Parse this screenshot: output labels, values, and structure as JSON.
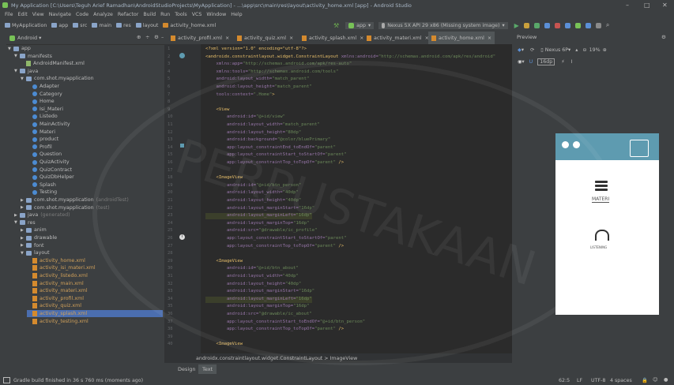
{
  "window": {
    "title": "My Application [C:\\Users\\Teguh Arief Ramadhan\\AndroidStudioProjects\\MyApplication] - ...\\app\\src\\main\\res\\layout\\activity_home.xml [app] - Android Studio"
  },
  "menu": [
    "File",
    "Edit",
    "View",
    "Navigate",
    "Code",
    "Analyze",
    "Refactor",
    "Build",
    "Run",
    "Tools",
    "VCS",
    "Window",
    "Help"
  ],
  "breadcrumb": [
    "MyApplication",
    "app",
    "src",
    "main",
    "res",
    "layout",
    "activity_home.xml"
  ],
  "toolbar": {
    "run_config": "app",
    "device": "Nexus 5X API 29 x86 (Missing system image)"
  },
  "project_panel": {
    "view_selector": "Android",
    "tree": [
      {
        "label": "app",
        "kind": "folder",
        "depth": 0,
        "open": true
      },
      {
        "label": "manifests",
        "kind": "folder",
        "depth": 1,
        "open": true
      },
      {
        "label": "AndroidManifest.xml",
        "kind": "manifest",
        "depth": 2
      },
      {
        "label": "java",
        "kind": "folder",
        "depth": 1,
        "open": true
      },
      {
        "label": "com.shot.myapplication",
        "kind": "folder",
        "depth": 2,
        "open": true
      },
      {
        "label": "Adapter",
        "kind": "class",
        "depth": 3
      },
      {
        "label": "Category",
        "kind": "class",
        "depth": 3
      },
      {
        "label": "Home",
        "kind": "class",
        "depth": 3
      },
      {
        "label": "Isi_Materi",
        "kind": "class",
        "depth": 3
      },
      {
        "label": "Listedo",
        "kind": "class",
        "depth": 3
      },
      {
        "label": "MainActivity",
        "kind": "class",
        "depth": 3
      },
      {
        "label": "Materi",
        "kind": "class",
        "depth": 3
      },
      {
        "label": "product",
        "kind": "class",
        "depth": 3
      },
      {
        "label": "Profil",
        "kind": "class",
        "depth": 3
      },
      {
        "label": "Question",
        "kind": "class",
        "depth": 3
      },
      {
        "label": "QuizActivity",
        "kind": "class",
        "depth": 3
      },
      {
        "label": "QuizContract",
        "kind": "class",
        "depth": 3
      },
      {
        "label": "QuizDbHelper",
        "kind": "class",
        "depth": 3
      },
      {
        "label": "Splash",
        "kind": "class",
        "depth": 3
      },
      {
        "label": "Testing",
        "kind": "class",
        "depth": 3
      },
      {
        "label": "com.shot.myapplication",
        "suffix": "(androidTest)",
        "kind": "folder",
        "depth": 2
      },
      {
        "label": "com.shot.myapplication",
        "suffix": "(test)",
        "kind": "folder",
        "depth": 2
      },
      {
        "label": "java",
        "suffix": "(generated)",
        "kind": "folder",
        "depth": 1
      },
      {
        "label": "res",
        "kind": "folder",
        "depth": 1,
        "open": true
      },
      {
        "label": "anim",
        "kind": "folder",
        "depth": 2
      },
      {
        "label": "drawable",
        "kind": "folder",
        "depth": 2
      },
      {
        "label": "font",
        "kind": "folder",
        "depth": 2
      },
      {
        "label": "layout",
        "kind": "folder",
        "depth": 2,
        "open": true
      },
      {
        "label": "activity_home.xml",
        "kind": "xml",
        "depth": 3
      },
      {
        "label": "activity_isi_materi.xml",
        "kind": "xml",
        "depth": 3
      },
      {
        "label": "activity_listedo.xml",
        "kind": "xml",
        "depth": 3
      },
      {
        "label": "activity_main.xml",
        "kind": "xml",
        "depth": 3
      },
      {
        "label": "activity_materi.xml",
        "kind": "xml",
        "depth": 3
      },
      {
        "label": "activity_profil.xml",
        "kind": "xml",
        "depth": 3
      },
      {
        "label": "activity_quiz.xml",
        "kind": "xml",
        "depth": 3
      },
      {
        "label": "activity_splash.xml",
        "kind": "xml",
        "depth": 3,
        "selected": true
      },
      {
        "label": "activity_testing.xml",
        "kind": "xml",
        "depth": 3
      }
    ]
  },
  "editor_tabs": [
    {
      "label": "activity_profil.xml",
      "active": false
    },
    {
      "label": "activity_quiz.xml",
      "active": false
    },
    {
      "label": "activity_splash.xml",
      "active": false
    },
    {
      "label": "activity_materi.xml",
      "active": false
    },
    {
      "label": "activity_home.xml",
      "active": true
    }
  ],
  "code_lines": [
    {
      "n": "1",
      "parts": [
        [
          "tg",
          "<?xml version=\"1.0\" encoding=\"utf-8\"?>"
        ]
      ]
    },
    {
      "n": "2",
      "parts": [
        [
          "tg",
          "<androidx.constraintlayout.widget.ConstraintLayout "
        ],
        [
          "at",
          "xmlns:android="
        ],
        [
          "st",
          "\"http://schemas.android.com/apk/res/android\""
        ]
      ]
    },
    {
      "n": "3",
      "parts": [
        [
          "at",
          "    xmlns:app="
        ],
        [
          "st",
          "\"http://schemas.android.com/apk/res-auto\""
        ]
      ]
    },
    {
      "n": "4",
      "parts": [
        [
          "at",
          "    xmlns:tools="
        ],
        [
          "st",
          "\"http://schemas.android.com/tools\""
        ]
      ]
    },
    {
      "n": "5",
      "parts": [
        [
          "at",
          "    android:layout_width="
        ],
        [
          "st",
          "\"match_parent\""
        ]
      ]
    },
    {
      "n": "6",
      "parts": [
        [
          "at",
          "    android:layout_height="
        ],
        [
          "st",
          "\"match_parent\""
        ]
      ]
    },
    {
      "n": "7",
      "parts": [
        [
          "at",
          "    tools:context="
        ],
        [
          "st",
          "\".Home\""
        ],
        [
          "tg",
          ">"
        ]
      ]
    },
    {
      "n": "8",
      "parts": [
        [
          "pl",
          ""
        ]
      ]
    },
    {
      "n": "9",
      "parts": [
        [
          "tg",
          "    <View"
        ]
      ]
    },
    {
      "n": "10",
      "parts": [
        [
          "at",
          "        android:id="
        ],
        [
          "st",
          "\"@+id/view\""
        ]
      ]
    },
    {
      "n": "11",
      "parts": [
        [
          "at",
          "        android:layout_width="
        ],
        [
          "st",
          "\"match_parent\""
        ]
      ]
    },
    {
      "n": "12",
      "parts": [
        [
          "at",
          "        android:layout_height="
        ],
        [
          "st",
          "\"80dp\""
        ]
      ]
    },
    {
      "n": "13",
      "parts": [
        [
          "at",
          "        android:background="
        ],
        [
          "st",
          "\"@color/bluePrimary\""
        ]
      ]
    },
    {
      "n": "14",
      "parts": [
        [
          "at",
          "        app:layout_constraintEnd_toEndOf="
        ],
        [
          "st",
          "\"parent\""
        ]
      ]
    },
    {
      "n": "15",
      "parts": [
        [
          "at",
          "        app:layout_constraintStart_toStartOf="
        ],
        [
          "st",
          "\"parent\""
        ]
      ]
    },
    {
      "n": "16",
      "parts": [
        [
          "at",
          "        app:layout_constraintTop_toTopOf="
        ],
        [
          "st",
          "\"parent\""
        ],
        [
          "tg",
          " />"
        ]
      ]
    },
    {
      "n": "17",
      "parts": [
        [
          "pl",
          ""
        ]
      ]
    },
    {
      "n": "18",
      "parts": [
        [
          "tg",
          "    <ImageView"
        ]
      ]
    },
    {
      "n": "19",
      "parts": [
        [
          "at",
          "        android:id="
        ],
        [
          "st",
          "\"@+id/btn_person\""
        ]
      ]
    },
    {
      "n": "20",
      "parts": [
        [
          "at",
          "        android:layout_width="
        ],
        [
          "st",
          "\"40dp\""
        ]
      ]
    },
    {
      "n": "21",
      "parts": [
        [
          "at",
          "        android:layout_height="
        ],
        [
          "st",
          "\"40dp\""
        ]
      ]
    },
    {
      "n": "22",
      "parts": [
        [
          "at",
          "        android:layout_marginStart="
        ],
        [
          "st",
          "\"16dp\""
        ]
      ]
    },
    {
      "n": "23",
      "parts": [
        [
          "at",
          "        android:layout_marginLeft="
        ],
        [
          "st",
          "\"16dp\""
        ]
      ],
      "hl": true
    },
    {
      "n": "24",
      "parts": [
        [
          "at",
          "        android:layout_marginTop="
        ],
        [
          "st",
          "\"16dp\""
        ]
      ]
    },
    {
      "n": "25",
      "parts": [
        [
          "at",
          "        android:src="
        ],
        [
          "st",
          "\"@drawable/ic_profile\""
        ]
      ]
    },
    {
      "n": "26",
      "parts": [
        [
          "at",
          "        app:layout_constraintStart_toStartOf="
        ],
        [
          "st",
          "\"parent\""
        ]
      ]
    },
    {
      "n": "27",
      "parts": [
        [
          "at",
          "        app:layout_constraintTop_toTopOf="
        ],
        [
          "st",
          "\"parent\""
        ],
        [
          "tg",
          " />"
        ]
      ]
    },
    {
      "n": "28",
      "parts": [
        [
          "pl",
          ""
        ]
      ]
    },
    {
      "n": "29",
      "parts": [
        [
          "tg",
          "    <ImageView"
        ]
      ]
    },
    {
      "n": "30",
      "parts": [
        [
          "at",
          "        android:id="
        ],
        [
          "st",
          "\"@+id/btn_about\""
        ]
      ]
    },
    {
      "n": "31",
      "parts": [
        [
          "at",
          "        android:layout_width="
        ],
        [
          "st",
          "\"40dp\""
        ]
      ]
    },
    {
      "n": "32",
      "parts": [
        [
          "at",
          "        android:layout_height="
        ],
        [
          "st",
          "\"40dp\""
        ]
      ]
    },
    {
      "n": "33",
      "parts": [
        [
          "at",
          "        android:layout_marginStart="
        ],
        [
          "st",
          "\"16dp\""
        ]
      ]
    },
    {
      "n": "34",
      "parts": [
        [
          "at",
          "        android:layout_marginLeft="
        ],
        [
          "st",
          "\"16dp\""
        ]
      ],
      "hl": true
    },
    {
      "n": "35",
      "parts": [
        [
          "at",
          "        android:layout_marginTop="
        ],
        [
          "st",
          "\"16dp\""
        ]
      ]
    },
    {
      "n": "36",
      "parts": [
        [
          "at",
          "        android:src="
        ],
        [
          "st",
          "\"@drawable/ic_about\""
        ]
      ]
    },
    {
      "n": "37",
      "parts": [
        [
          "at",
          "        app:layout_constraintStart_toEndOf="
        ],
        [
          "st",
          "\"@+id/btn_person\""
        ]
      ]
    },
    {
      "n": "38",
      "parts": [
        [
          "at",
          "        app:layout_constraintTop_toTopOf="
        ],
        [
          "st",
          "\"parent\""
        ],
        [
          "tg",
          " />"
        ]
      ]
    },
    {
      "n": "39",
      "parts": [
        [
          "pl",
          ""
        ]
      ]
    },
    {
      "n": "40",
      "parts": [
        [
          "tg",
          "    <ImageView"
        ]
      ]
    }
  ],
  "editor_breadcrumb": "androidx.constraintlayout.widget.ConstraintLayout  >  ImageView",
  "design_tabs": [
    "Design",
    "Text"
  ],
  "preview": {
    "title": "Preview",
    "device": "Nexus 6P",
    "zoom": "19%",
    "api": "29",
    "materi_label": "MATERI",
    "listening_label": "LISTENING"
  },
  "watermark": "PERPUSTAKAAN",
  "status": {
    "message": "Gradle build finished in 36 s 760 ms (moments ago)",
    "position": "62:5",
    "line_sep": "LF",
    "encoding": "UTF-8",
    "indent": "4 spaces"
  },
  "colors": {
    "accent": "#4a88c7",
    "phone_header": "#5e9bb0"
  }
}
